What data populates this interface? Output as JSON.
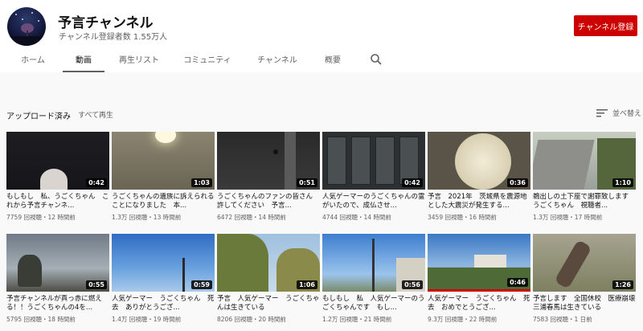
{
  "channel": {
    "name": "予言チャンネル",
    "subscribers": "チャンネル登録者数 1.55万人",
    "subscribe_label": "チャンネル登録"
  },
  "tabs": [
    {
      "label": "ホーム"
    },
    {
      "label": "動画"
    },
    {
      "label": "再生リスト"
    },
    {
      "label": "コミュニティ"
    },
    {
      "label": "チャンネル"
    },
    {
      "label": "概要"
    }
  ],
  "section": {
    "title": "アップロード済み",
    "play_all": "すべて再生",
    "sort_label": "並べ替え"
  },
  "videos": [
    {
      "title": "もしもし　私、うごくちゃん　これから予言チャンネ...",
      "meta": "7759 回視聴・12 時間前",
      "duration": "0:42"
    },
    {
      "title": "うごくちゃんの遺族に訴えられることになりました　本...",
      "meta": "1.3万 回視聴・13 時間前",
      "duration": "1:03"
    },
    {
      "title": "うごくちゃんのファンの皆さん　許してください　予言...",
      "meta": "6472 回視聴・14 時間前",
      "duration": "0:51"
    },
    {
      "title": "人気ゲーマーのうごくちゃんの霊がいたので、成仏させ...",
      "meta": "4744 回視聴・14 時間前",
      "duration": "0:42"
    },
    {
      "title": "予言　2021年　茨城県を震源地とした大震災が発生する...",
      "meta": "3459 回視聴・16 時間前",
      "duration": "0:36"
    },
    {
      "title": "鵜出しの土下座で謝罪致します　うごくちゃん　視聴者...",
      "meta": "1.3万 回視聴・17 時間前",
      "duration": "1:10"
    },
    {
      "title": "予言チャンネルが真っ赤に燃える！！うごくちゃんの4を...",
      "meta": "5795 回視聴・18 時間前",
      "duration": "0:55"
    },
    {
      "title": "人気ゲーマー　うごくちゃん　死去　ありがとうござ...",
      "meta": "1.4万 回視聴・19 時間前",
      "duration": "0:59"
    },
    {
      "title": "予言　人気ゲーマー　うごくちゃんは生きている",
      "meta": "8206 回視聴・20 時間前",
      "duration": "1:06"
    },
    {
      "title": "もしもし　私　人気ゲーマーのうごくちゃんです　もし...",
      "meta": "1.2万 回視聴・21 時間前",
      "duration": "0:56"
    },
    {
      "title": "人気ゲーマー　うごくちゃん　死去　おめでとうござ...",
      "meta": "9.3万 回視聴・22 時間前",
      "duration": "0:46"
    },
    {
      "title": "予言します　全国休校　医療崩壊　三浦春馬は生きている",
      "meta": "7583 回視聴・1 日前",
      "duration": "1:26"
    }
  ]
}
